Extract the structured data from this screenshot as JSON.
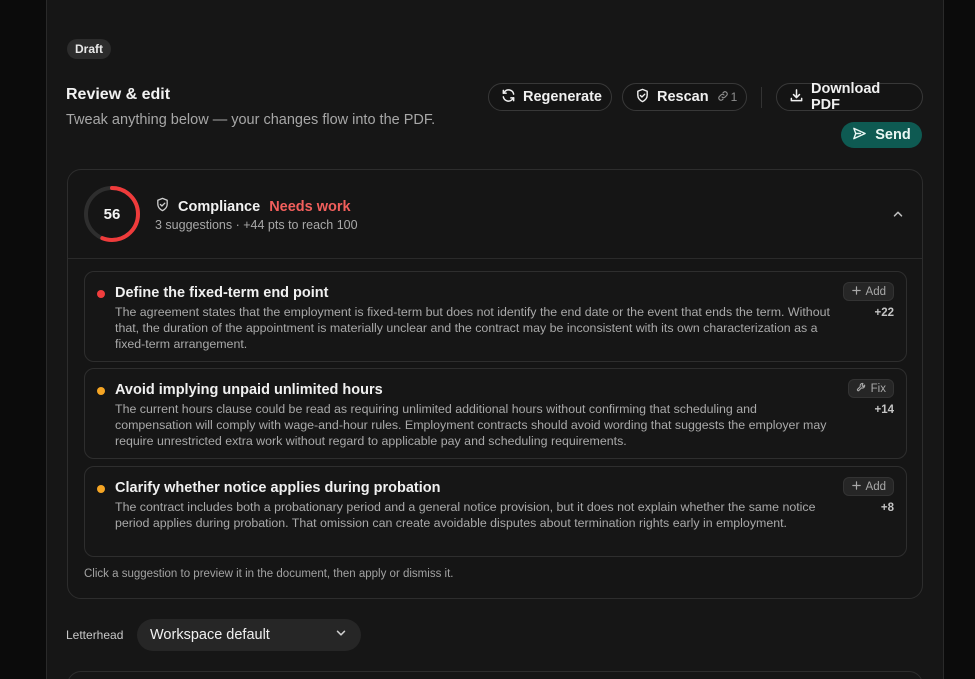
{
  "header": {
    "badge": "Draft",
    "title": "Review & edit",
    "subtitle": "Tweak anything below — your changes flow into the PDF."
  },
  "actions": {
    "regenerate": "Regenerate",
    "rescan": "Rescan",
    "rescan_count": "1",
    "download": "Download PDF",
    "send": "Send"
  },
  "compliance": {
    "score": "56",
    "score_fraction": 0.56,
    "title": "Compliance",
    "status": "Needs work",
    "summary": "3 suggestions · +44 pts to reach 100",
    "colors": {
      "ring": "#ef3b3b",
      "status": "#f25f5c"
    },
    "suggestions": [
      {
        "title": "Define the fixed-term end point",
        "body": "The agreement states that the employment is fixed-term but does not identify the end date or the event that ends the term. Without that, the duration of the appointment is materially unclear and the contract may be inconsistent with its own characterization as a fixed-term arrangement.",
        "action": "Add",
        "action_icon": "plus-icon",
        "points": "+22",
        "severity_color": "#f03d3d"
      },
      {
        "title": "Avoid implying unpaid unlimited hours",
        "body": "The current hours clause could be read as requiring unlimited additional hours without confirming that scheduling and compensation will comply with wage-and-hour rules. Employment contracts should avoid wording that suggests the employer may require unrestricted extra work without regard to applicable pay and scheduling requirements.",
        "action": "Fix",
        "action_icon": "wrench-icon",
        "points": "+14",
        "severity_color": "#f5a524"
      },
      {
        "title": "Clarify whether notice applies during probation",
        "body": "The contract includes both a probationary period and a general notice provision, but it does not explain whether the same notice period applies during probation. That omission can create avoidable disputes about termination rights early in employment.",
        "action": "Add",
        "action_icon": "plus-icon",
        "points": "+8",
        "severity_color": "#f5a524"
      }
    ],
    "hint": "Click a suggestion to preview it in the document, then apply or dismiss it."
  },
  "letterhead": {
    "label": "Letterhead",
    "value": "Workspace default"
  }
}
